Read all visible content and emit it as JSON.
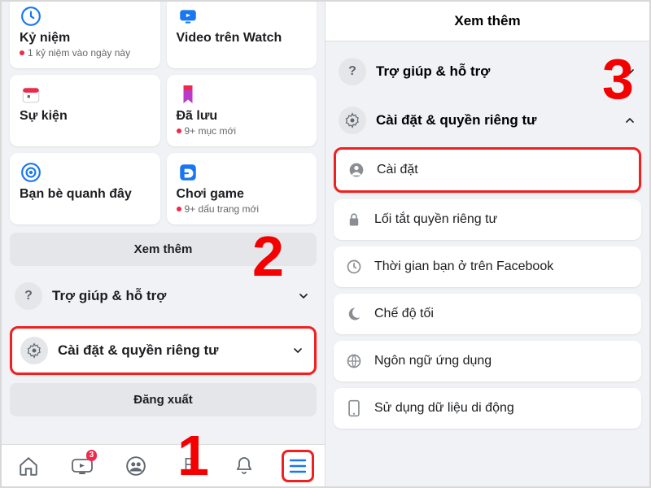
{
  "left": {
    "cards": [
      {
        "title": "Kỷ niệm",
        "sub": "1 kỷ niệm vào ngày này"
      },
      {
        "title": "Video trên Watch",
        "sub": ""
      },
      {
        "title": "Sự kiện",
        "sub": ""
      },
      {
        "title": "Đã lưu",
        "sub": "9+ mục mới"
      },
      {
        "title": "Bạn bè quanh đây",
        "sub": ""
      },
      {
        "title": "Chơi game",
        "sub": "9+ dấu trang mới"
      }
    ],
    "see_more": "Xem thêm",
    "help_label": "Trợ giúp & hỗ trợ",
    "settings_label": "Cài đặt & quyền riêng tư",
    "logout": "Đăng xuất",
    "badge": "3"
  },
  "right": {
    "header": "Xem thêm",
    "help_label": "Trợ giúp & hỗ trợ",
    "settings_label": "Cài đặt & quyền riêng tư",
    "items": [
      "Cài đặt",
      "Lối tắt quyền riêng tư",
      "Thời gian bạn ở trên Facebook",
      "Chế độ tối",
      "Ngôn ngữ ứng dụng",
      "Sử dụng dữ liệu di động"
    ]
  },
  "steps": {
    "s1": "1",
    "s2": "2",
    "s3": "3"
  }
}
